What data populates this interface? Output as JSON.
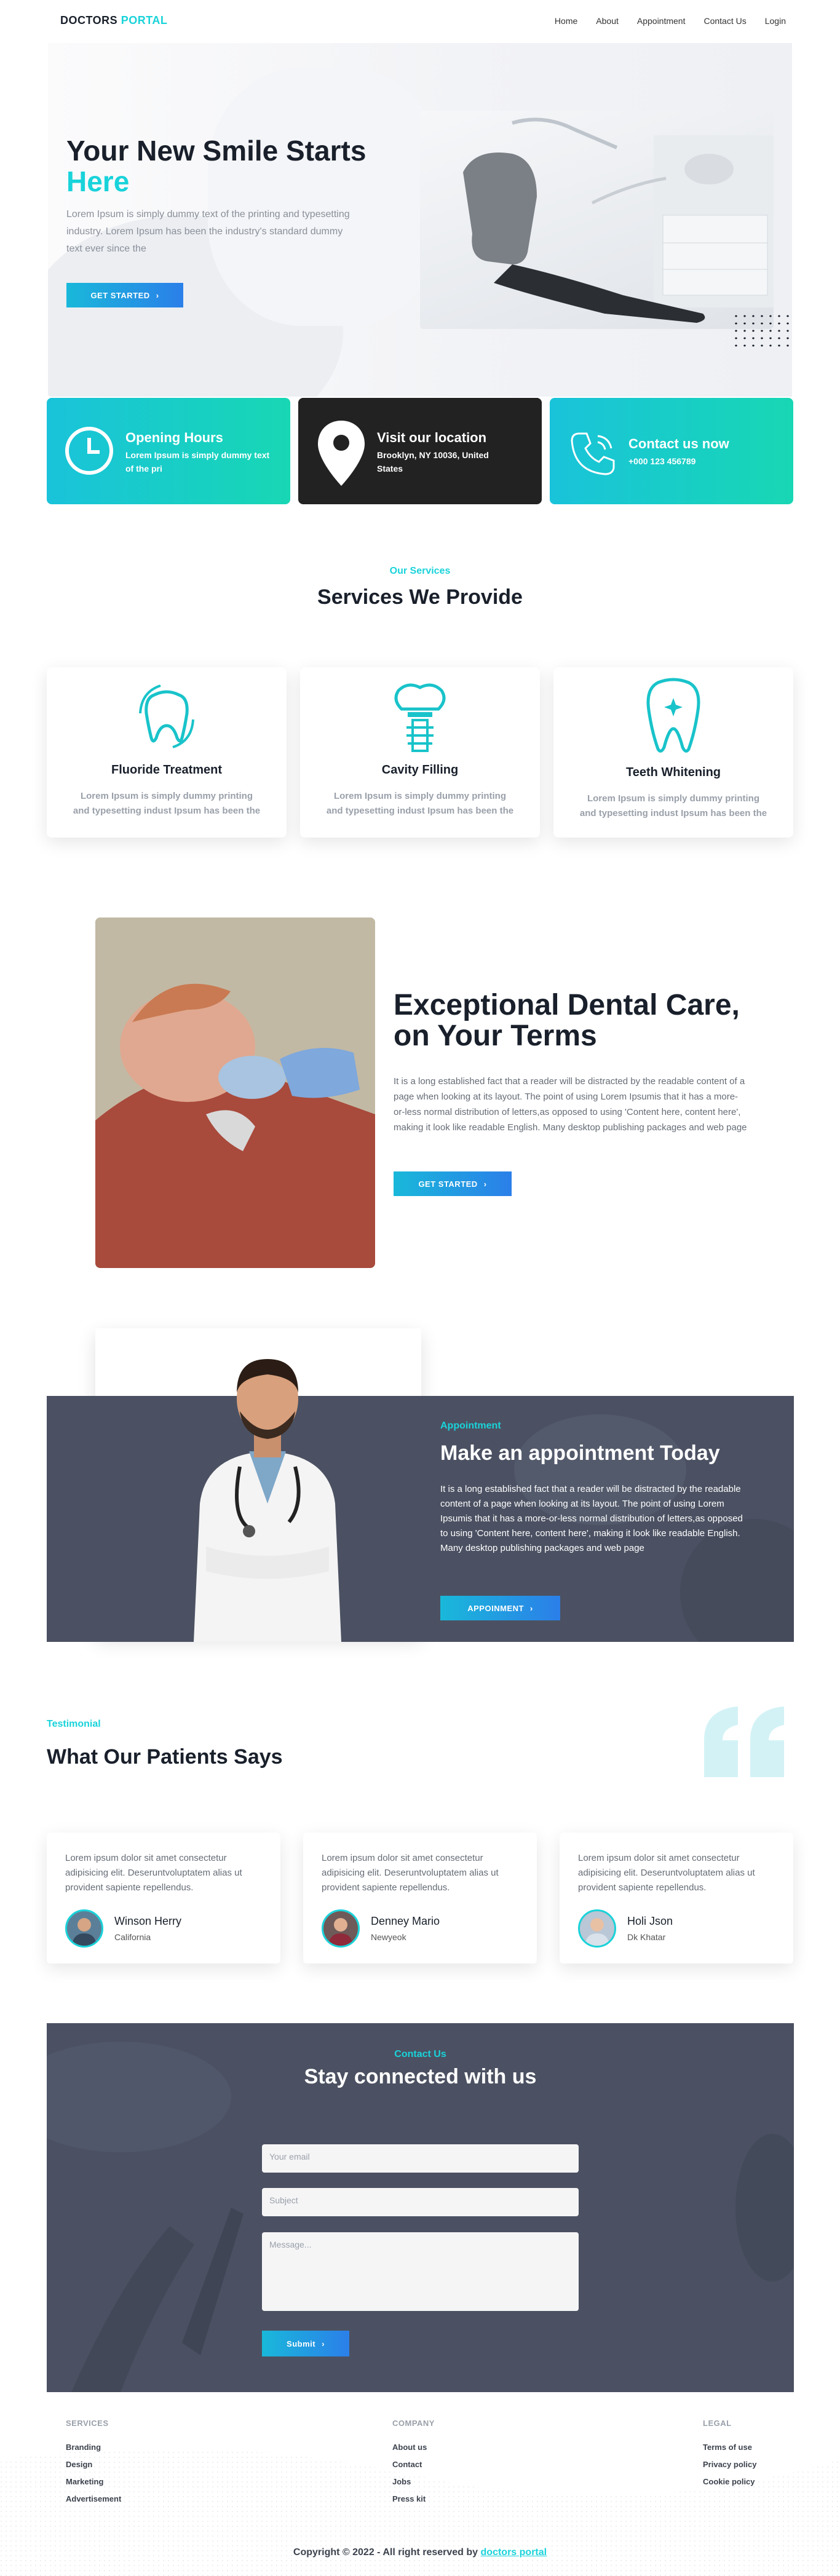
{
  "nav": {
    "logo_part1": "DOCTORS",
    "logo_part2": "PORTAL",
    "links": [
      "Home",
      "About",
      "Appointment",
      "Contact Us",
      "Login"
    ]
  },
  "hero": {
    "title_line1": "Your New Smile Starts",
    "title_line2": "Here",
    "description": "Lorem Ipsum is simply dummy text of the printing and typesetting industry. Lorem Ipsum has been the industry's standard dummy text ever since the",
    "cta": "GET STARTED"
  },
  "info_cards": [
    {
      "title": "Opening Hours",
      "text": "Lorem Ipsum is simply dummy text of the pri",
      "icon": "clock-icon"
    },
    {
      "title": "Visit our location",
      "text": "Brooklyn, NY 10036, United States",
      "icon": "location-pin-icon"
    },
    {
      "title": "Contact us now",
      "text": "+000 123 456789",
      "icon": "phone-icon"
    }
  ],
  "services": {
    "subtitle": "Our Services",
    "title": "Services We Provide",
    "items": [
      {
        "title": "Fluoride Treatment",
        "text": "Lorem Ipsum is simply dummy printing and typesetting indust Ipsum has been the",
        "icon": "tooth-fluoride-icon"
      },
      {
        "title": "Cavity Filling",
        "text": "Lorem Ipsum is simply dummy printing and typesetting indust Ipsum has been the",
        "icon": "tooth-implant-icon"
      },
      {
        "title": "Teeth Whitening",
        "text": "Lorem Ipsum is simply dummy printing and typesetting indust Ipsum has been the",
        "icon": "tooth-sparkle-icon"
      }
    ]
  },
  "dental_care": {
    "title_line1": "Exceptional Dental Care,",
    "title_line2": "on Your Terms",
    "text": "It is a long established fact that a reader will be distracted by the readable content of a page when looking at its layout. The point of using Lorem Ipsumis that it has a more-or-less normal distribution of letters,as opposed to using 'Content here, content here', making it look like readable English. Many desktop publishing packages and web page",
    "cta": "GET STARTED"
  },
  "appointment": {
    "subtitle": "Appointment",
    "title": "Make an appointment Today",
    "text": "It is a long established fact that a reader will be distracted by the readable content of a page when looking at its layout. The point of using Lorem Ipsumis that it has a more-or-less normal distribution of letters,as opposed to using 'Content here, content here', making it look like readable English. Many desktop publishing packages and web page",
    "cta": "APPOINMENT"
  },
  "testimonials": {
    "subtitle": "Testimonial",
    "title": "What Our Patients Says",
    "items": [
      {
        "text": "Lorem ipsum dolor sit amet consectetur adipisicing elit. Deseruntvoluptatem alias ut provident sapiente repellendus.",
        "name": "Winson Herry",
        "place": "California"
      },
      {
        "text": "Lorem ipsum dolor sit amet consectetur adipisicing elit. Deseruntvoluptatem alias ut provident sapiente repellendus.",
        "name": "Denney Mario",
        "place": "Newyeok"
      },
      {
        "text": "Lorem ipsum dolor sit amet consectetur adipisicing elit. Deseruntvoluptatem alias ut provident sapiente repellendus.",
        "name": "Holi Json",
        "place": "Dk Khatar"
      }
    ]
  },
  "contact": {
    "subtitle": "Contact Us",
    "title": "Stay connected with us",
    "email_placeholder": "Your email",
    "subject_placeholder": "Subject",
    "message_placeholder": "Message...",
    "submit": "Submit"
  },
  "footer": {
    "columns": [
      {
        "heading": "SERVICES",
        "links": [
          "Branding",
          "Design",
          "Marketing",
          "Advertisement"
        ]
      },
      {
        "heading": "COMPANY",
        "links": [
          "About us",
          "Contact",
          "Jobs",
          "Press kit"
        ]
      },
      {
        "heading": "LEGAL",
        "links": [
          "Terms of use",
          "Privacy policy",
          "Cookie policy"
        ]
      }
    ],
    "copyright": "Copyright © 2022 - All right reserved by",
    "copyright_link": "doctors portal"
  },
  "colors": {
    "accent": "#19d3da",
    "button_gradient_start": "#19b8da",
    "button_gradient_end": "#2b7fe9",
    "dark_card": "#222222",
    "slate_panel": "#4b5162",
    "heading": "#19202b"
  }
}
